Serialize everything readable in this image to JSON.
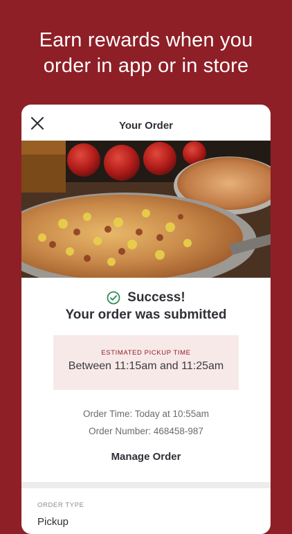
{
  "headline": {
    "line1": "Earn rewards when you",
    "line2": "order in app or in store"
  },
  "card": {
    "title": "Your Order",
    "close_icon": "close-icon",
    "hero_image": "pizza-photo",
    "success_title": "Success!",
    "success_subtitle": "Your order was submitted",
    "pickup_label": "ESTIMATED PICKUP TIME",
    "pickup_time": "Between 11:15am and 11:25am",
    "order_time": "Order Time: Today at 10:55am",
    "order_number": "Order Number: 468458-987",
    "manage_label": "Manage Order",
    "order_type_label": "ORDER TYPE",
    "order_type_value": "Pickup"
  },
  "colors": {
    "brand": "#8e1f27",
    "success": "#2e8b57",
    "pickup_bg": "#f7e9e8"
  }
}
